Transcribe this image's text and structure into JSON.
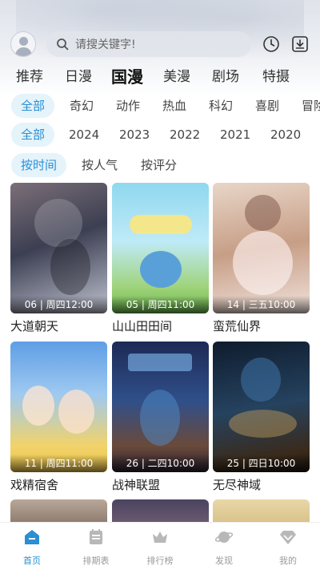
{
  "header": {
    "search_placeholder": "请搜关键字!",
    "icons": [
      "avatar-icon",
      "search-icon",
      "clock-icon",
      "download-icon"
    ]
  },
  "main_tabs": [
    {
      "label": "推荐",
      "active": false
    },
    {
      "label": "日漫",
      "active": false
    },
    {
      "label": "国漫",
      "active": true
    },
    {
      "label": "美漫",
      "active": false
    },
    {
      "label": "剧场",
      "active": false
    },
    {
      "label": "特摄",
      "active": false
    }
  ],
  "genre_filter": [
    "全部",
    "奇幻",
    "动作",
    "热血",
    "科幻",
    "喜剧",
    "冒险"
  ],
  "year_filter": [
    "全部",
    "2024",
    "2023",
    "2022",
    "2021",
    "2020"
  ],
  "sort_filter": [
    "按时间",
    "按人气",
    "按评分"
  ],
  "cards": [
    {
      "title": "大道朝天",
      "badge": "06 | 周四12:00",
      "color": "#5b5f6e"
    },
    {
      "title": "山山田田间",
      "badge": "05 | 周四11:00",
      "color": "#8fd3e8"
    },
    {
      "title": "蛮荒仙界",
      "badge": "14 | 三五10:00",
      "color": "#c9a48f"
    },
    {
      "title": "戏精宿舍",
      "badge": "11 | 周四11:00",
      "color": "#6aa7e6"
    },
    {
      "title": "战神联盟",
      "badge": "26 | 二四10:00",
      "color": "#2b3f6e"
    },
    {
      "title": "无尽神域",
      "badge": "25 | 四日10:00",
      "color": "#1f3550"
    }
  ],
  "bottom_nav": [
    {
      "label": "首页",
      "icon": "home-icon",
      "active": true
    },
    {
      "label": "排期表",
      "icon": "calendar-icon",
      "active": false
    },
    {
      "label": "排行榜",
      "icon": "crown-icon",
      "active": false
    },
    {
      "label": "发现",
      "icon": "planet-icon",
      "active": false
    },
    {
      "label": "我的",
      "icon": "diamond-icon",
      "active": false
    }
  ],
  "colors": {
    "accent": "#2a8fd3",
    "chip_bg": "#e5f3fb"
  }
}
